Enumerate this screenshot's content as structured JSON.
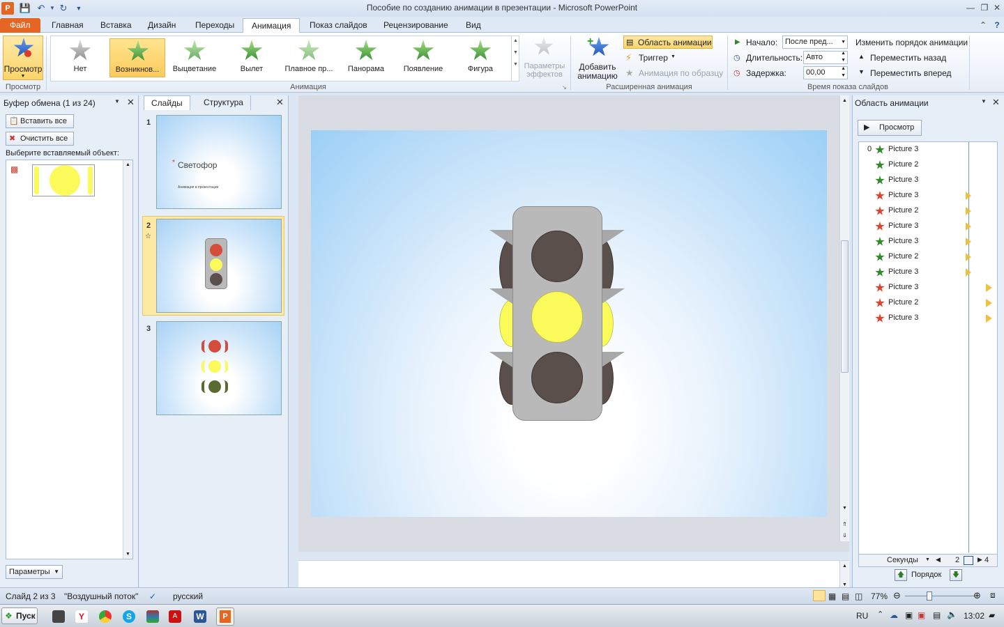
{
  "window": {
    "title": "Пособие по созданию анимации в презентации  -  Microsoft PowerPoint"
  },
  "tabs": [
    "Файл",
    "Главная",
    "Вставка",
    "Дизайн",
    "Переходы",
    "Анимация",
    "Показ слайдов",
    "Рецензирование",
    "Вид"
  ],
  "ribbon": {
    "preview": {
      "label": "Просмотр",
      "group": "Просмотр"
    },
    "animation_gallery": {
      "group": "Анимация",
      "items": [
        "Нет",
        "Возникнов...",
        "Выцветание",
        "Вылет",
        "Плавное пр...",
        "Панорама",
        "Появление",
        "Фигура"
      ],
      "selected": "Возникнов...",
      "effect_options_l1": "Параметры",
      "effect_options_l2": "эффектов"
    },
    "advanced": {
      "group": "Расширенная анимация",
      "add_l1": "Добавить",
      "add_l2": "анимацию",
      "pane": "Область анимации",
      "trigger": "Триггер",
      "painter": "Анимация по образцу"
    },
    "timing": {
      "group": "Время показа слайдов",
      "start_label": "Начало:",
      "start_value": "После пред...",
      "duration_label": "Длительность:",
      "duration_value": "Авто",
      "delay_label": "Задержка:",
      "delay_value": "00,00",
      "reorder_title": "Изменить порядок анимации",
      "move_back": "Переместить назад",
      "move_forward": "Переместить вперед"
    }
  },
  "clipboard": {
    "title": "Буфер обмена (1 из 24)",
    "paste_all": "Вставить все",
    "clear_all": "Очистить все",
    "prompt": "Выберите вставляемый объект:",
    "options": "Параметры"
  },
  "slides_pane": {
    "tab_slides": "Слайды",
    "tab_outline": "Структура",
    "thumbs": [
      {
        "num": "1",
        "title": "Светофор",
        "subtitle": "Анимация в презентации"
      },
      {
        "num": "2"
      },
      {
        "num": "3"
      }
    ]
  },
  "animation_pane": {
    "title": "Область анимации",
    "play": "Просмотр",
    "first_number": "0",
    "items": [
      {
        "name": "Picture 3",
        "type": "entrance"
      },
      {
        "name": "Picture 2",
        "type": "entrance"
      },
      {
        "name": "Picture 3",
        "type": "entrance"
      },
      {
        "name": "Picture 3",
        "type": "exit"
      },
      {
        "name": "Picture 2",
        "type": "exit"
      },
      {
        "name": "Picture 3",
        "type": "exit"
      },
      {
        "name": "Picture 3",
        "type": "entrance"
      },
      {
        "name": "Picture 2",
        "type": "entrance"
      },
      {
        "name": "Picture 3",
        "type": "entrance"
      },
      {
        "name": "Picture 3",
        "type": "exit"
      },
      {
        "name": "Picture 2",
        "type": "exit"
      },
      {
        "name": "Picture 3",
        "type": "exit"
      }
    ],
    "seconds": "Секунды",
    "timeline_2": "2",
    "timeline_4": "4",
    "reorder": "Порядок"
  },
  "status": {
    "slide": "Слайд 2 из 3",
    "theme": "\"Воздушный поток\"",
    "language": "русский",
    "zoom": "77%"
  },
  "taskbar": {
    "start": "Пуск",
    "lang": "RU",
    "time": "13:02"
  },
  "colors": {
    "file_tab": "#e56622",
    "selected_item": "#fcca5c",
    "entrance_star": "#2f8a2a",
    "exit_star": "#e0402c",
    "lamp_dark": "#5a4f4a",
    "lamp_yellow": "#fafa5a",
    "lamp_red": "#d64c3b"
  }
}
